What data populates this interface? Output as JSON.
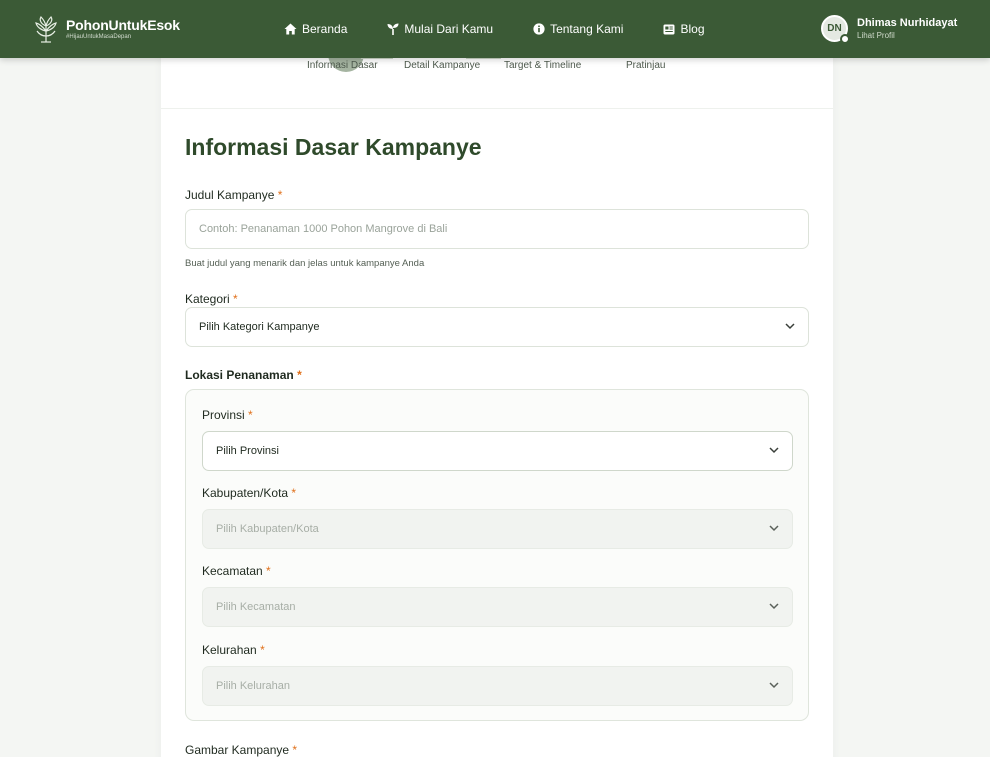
{
  "navbar": {
    "brand_name": "PohonUntukEsok",
    "brand_tag": "#HijauUntukMasaDepan",
    "links": [
      {
        "label": "Beranda",
        "icon": "home-icon"
      },
      {
        "label": "Mulai Dari Kamu",
        "icon": "sprout-icon"
      },
      {
        "label": "Tentang Kami",
        "icon": "info-icon"
      },
      {
        "label": "Blog",
        "icon": "blog-icon"
      }
    ],
    "user": {
      "initials": "DN",
      "name": "Dhimas Nurhidayat",
      "link": "Lihat Profil"
    }
  },
  "steps": [
    "Informasi Dasar",
    "Detail Kampanye",
    "Target & Timeline",
    "Pratinjau"
  ],
  "form": {
    "title": "Informasi Dasar Kampanye",
    "judul": {
      "label": "Judul Kampanye",
      "placeholder": "Contoh: Penanaman 1000 Pohon Mangrove di Bali",
      "help": "Buat judul yang menarik dan jelas untuk kampanye Anda"
    },
    "kategori": {
      "label": "Kategori",
      "value": "Pilih Kategori Kampanye"
    },
    "lokasi": {
      "label": "Lokasi Penanaman",
      "provinsi": {
        "label": "Provinsi",
        "value": "Pilih Provinsi"
      },
      "kabupaten": {
        "label": "Kabupaten/Kota",
        "value": "Pilih Kabupaten/Kota"
      },
      "kecamatan": {
        "label": "Kecamatan",
        "value": "Pilih Kecamatan"
      },
      "kelurahan": {
        "label": "Kelurahan",
        "value": "Pilih Kelurahan"
      }
    },
    "gambar": {
      "label": "Gambar Kampanye"
    },
    "required_mark": "*"
  },
  "colors": {
    "primary": "#3b5a36",
    "accent": "#e0701a",
    "title": "#2f4a2b"
  }
}
